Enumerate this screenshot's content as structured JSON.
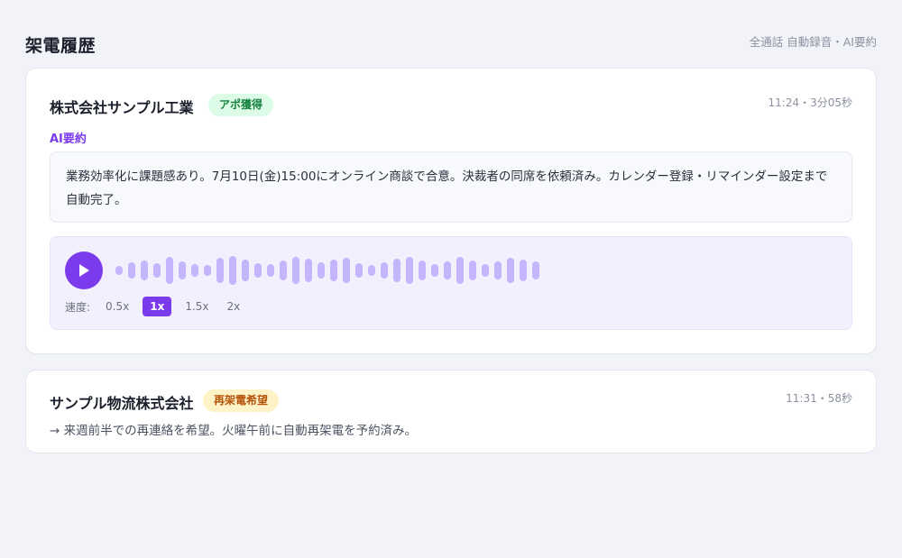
{
  "header": {
    "title": "架電履歴",
    "note": "全通話 自動録音・AI要約"
  },
  "calls": [
    {
      "company": "株式会社サンプル工業",
      "badge": "アポ獲得",
      "meta": "11:24・3分05秒",
      "ai_label": "AI要約",
      "summary": "業務効率化に課題感あり。7月10日(金)15:00にオンライン商談で合意。決裁者の同席を依頼済み。カレンダー登録・リマインダー設定まで自動完了。",
      "player": {
        "play_icon": "play-icon",
        "speed_label": "速度:",
        "speeds": [
          "0.5x",
          "1x",
          "1.5x",
          "2x"
        ],
        "selected_speed": "1x"
      }
    },
    {
      "company": "サンプル物流株式会社",
      "badge": "再架電希望",
      "meta": "11:31・58秒",
      "note": "→ 来週前半での再連絡を希望。火曜午前に自動再架電を予約済み。"
    }
  ],
  "colors": {
    "accent": "#7c3aed",
    "badge_success_bg": "#dcfce7",
    "badge_success_text": "#15803d",
    "badge_warning_bg": "#fef3c7",
    "badge_warning_text": "#b45309",
    "waveform": "#c4b5fd"
  }
}
